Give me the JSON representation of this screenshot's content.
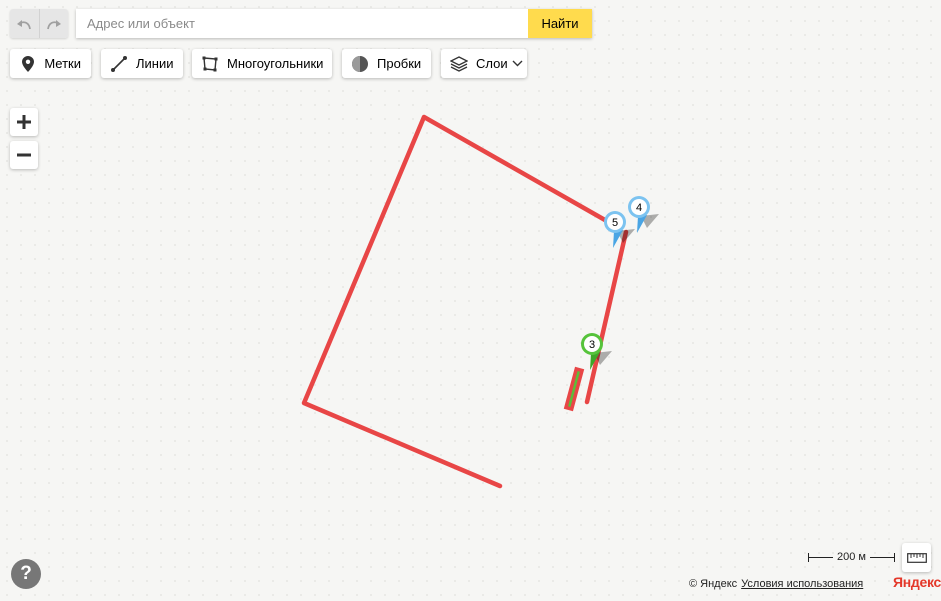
{
  "search": {
    "placeholder": "Адрес или объект",
    "value": "",
    "submit_label": "Найти"
  },
  "history": {
    "undo_icon": "undo-icon",
    "redo_icon": "redo-icon"
  },
  "toolbar": {
    "placemarks_label": "Метки",
    "lines_label": "Линии",
    "polygons_label": "Многоугольники",
    "traffic_label": "Пробки",
    "layers_label": "Слои"
  },
  "zoom": {
    "in_icon": "plus-icon",
    "out_icon": "minus-icon"
  },
  "placemarks": [
    {
      "label": "5",
      "color": "#7cc3f0"
    },
    {
      "label": "4",
      "color": "#7cc3f0"
    },
    {
      "label": "3",
      "color": "#56c33b"
    }
  ],
  "line_color": "#e84646",
  "scale": {
    "text": "200 м"
  },
  "footer": {
    "copyright": "© Яндекс",
    "terms_link": "Условия использования",
    "logo": "Яндекс"
  },
  "help": {
    "label": "?"
  }
}
